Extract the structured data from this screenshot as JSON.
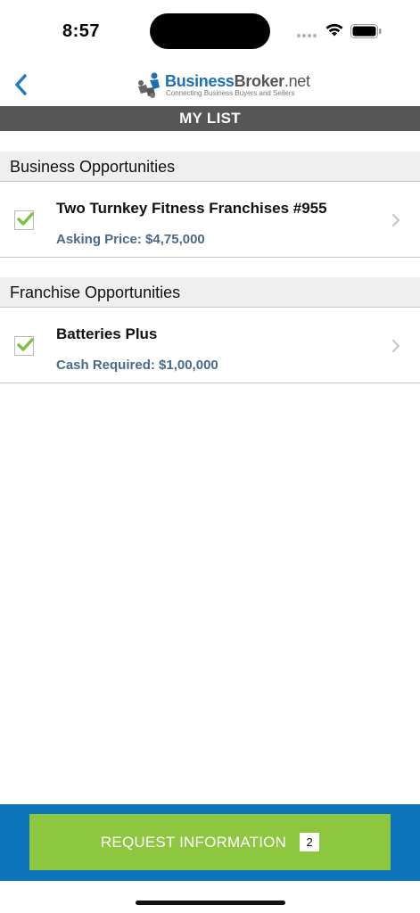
{
  "status_bar": {
    "time": "8:57"
  },
  "nav": {
    "back_icon": "chevron-left-icon",
    "logo": {
      "name_part1": "Business",
      "name_part2": "Broker",
      "name_part3": ".net",
      "tagline": "Connecting Business Buyers and Sellers"
    }
  },
  "title": "MY LIST",
  "sections": [
    {
      "header": "Business Opportunities",
      "items": [
        {
          "title": "Two Turnkey Fitness Franchises #955",
          "price": "Asking Price: $4,75,000",
          "checked": true
        }
      ]
    },
    {
      "header": "Franchise Opportunities",
      "items": [
        {
          "title": "Batteries Plus",
          "price": "Cash Required: $1,00,000",
          "checked": true
        }
      ]
    }
  ],
  "footer": {
    "button_label": "REQUEST INFORMATION",
    "count": "2"
  },
  "colors": {
    "accent_blue": "#0c75b9",
    "button_green": "#8dc63f",
    "title_bar": "#565656",
    "price_text": "#4a6a8a",
    "check_green": "#7dc242"
  }
}
